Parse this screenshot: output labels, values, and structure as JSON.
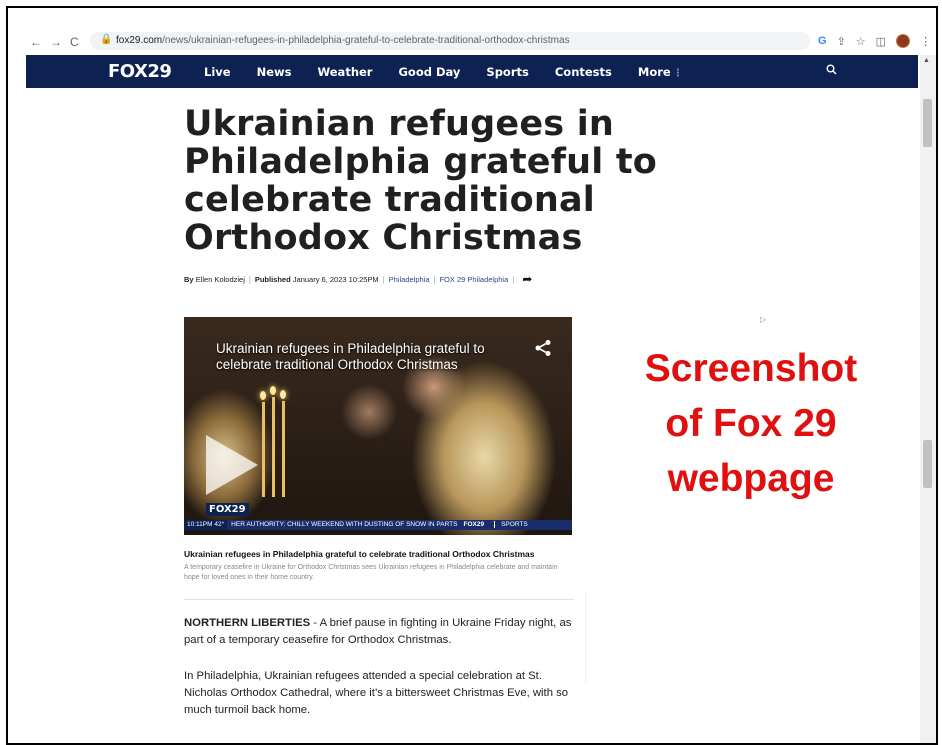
{
  "browser": {
    "back": "←",
    "forward": "→",
    "reload": "C",
    "url_domain": "fox29.com",
    "url_path": "/news/ukrainian-refugees-in-philadelphia-grateful-to-celebrate-traditional-orthodox-christmas"
  },
  "site": {
    "logo": "FOX29",
    "nav": [
      "Live",
      "News",
      "Weather",
      "Good Day",
      "Sports",
      "Contests",
      "More"
    ],
    "more_glyph": "⋮",
    "brand_color": "#0d2153"
  },
  "article": {
    "headline": "Ukrainian refugees in Philadelphia grateful to celebrate traditional Orthodox Christmas",
    "byline": {
      "by_label": "By",
      "author": "Ellen Kolodziej",
      "published_label": "Published",
      "date": "January 6, 2023 10:25PM",
      "location": "Philadelphia",
      "source": "FOX 29 Philadelphia"
    },
    "video": {
      "title": "Ukrainian refugees in Philadelphia grateful to celebrate traditional Orthodox Christmas",
      "logo": "FOX29",
      "ticker_time": "10:11PM  42°",
      "ticker_text": "HER AUTHORITY: CHILLY WEEKEND WITH DUSTING OF SNOW IN PARTS",
      "ticker_logo": "FOX29",
      "ticker_section": "SPORTS"
    },
    "caption": {
      "title": "Ukrainian refugees in Philadelphia grateful to celebrate traditional Orthodox Christmas",
      "description": "A temporary ceasefire in Ukraine for Orthodox Christmas sees Ukrainian refugees in Philadelphia celebrate and maintain hope for loved ones in their home country."
    },
    "paragraphs": [
      {
        "dateline": "NORTHERN LIBERTIES",
        "text": " - A brief pause in fighting in Ukraine Friday night, as part of a temporary ceasefire for Orthodox Christmas."
      },
      {
        "dateline": "",
        "text": "In Philadelphia, Ukrainian refugees attended a special celebration at St. Nicholas Orthodox Cathedral, where it’s a bittersweet Christmas Eve, with so much turmoil back home."
      }
    ]
  },
  "overlay": {
    "lines": [
      "Screenshot",
      "of Fox 29",
      "webpage"
    ],
    "color": "#e01010"
  }
}
